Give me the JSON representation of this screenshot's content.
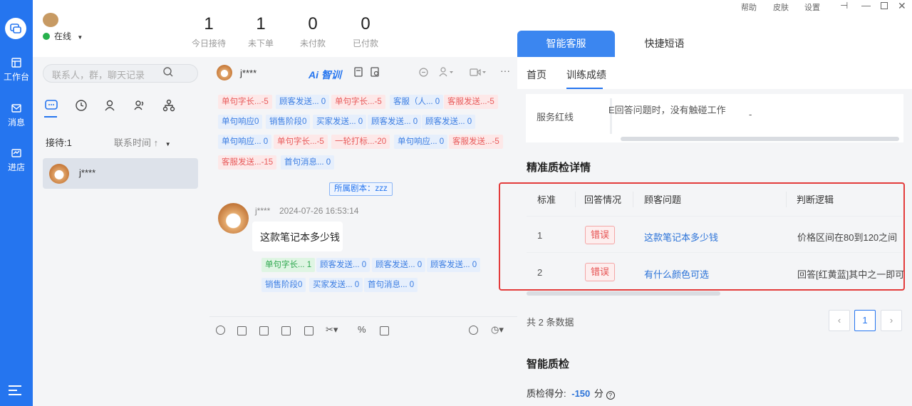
{
  "rail": {
    "items": [
      {
        "label": "工作台"
      },
      {
        "label": "消息"
      },
      {
        "label": "进店"
      }
    ]
  },
  "header": {
    "status": "在线",
    "stats": [
      {
        "value": "1",
        "label": "今日接待"
      },
      {
        "value": "1",
        "label": "未下单"
      },
      {
        "value": "0",
        "label": "未付款"
      },
      {
        "value": "0",
        "label": "已付款"
      }
    ],
    "window_menu": [
      "帮助",
      "皮肤",
      "设置"
    ]
  },
  "contacts": {
    "search_placeholder": "联系人，群，聊天记录",
    "reception": "接待:1",
    "sort": "联系时间",
    "items": [
      {
        "name": "j****"
      }
    ]
  },
  "chat": {
    "contact_name": "j****",
    "ai_label": "Ai 智训",
    "top_tags": [
      {
        "text": "单句字长...-5",
        "color": "red"
      },
      {
        "text": "顾客发送... 0",
        "color": "blue"
      },
      {
        "text": "单句字长...-5",
        "color": "red"
      },
      {
        "text": "客服（人... 0",
        "color": "blue"
      },
      {
        "text": "客服发送...-5",
        "color": "red"
      },
      {
        "text": "单句响应0",
        "color": "blue"
      },
      {
        "text": "销售阶段0",
        "color": "blue"
      },
      {
        "text": "买家发送... 0",
        "color": "blue"
      },
      {
        "text": "顾客发送... 0",
        "color": "blue"
      },
      {
        "text": "顾客发送... 0",
        "color": "blue"
      },
      {
        "text": "单句响应... 0",
        "color": "blue"
      },
      {
        "text": "单句字长...-5",
        "color": "red"
      },
      {
        "text": "一轮打标...-20",
        "color": "red"
      },
      {
        "text": "单句响应... 0",
        "color": "blue"
      },
      {
        "text": "客服发送...-5",
        "color": "red"
      },
      {
        "text": "客服发送...-15",
        "color": "red"
      },
      {
        "text": "首句消息... 0",
        "color": "blue"
      }
    ],
    "script_label": "所属剧本：zzz",
    "message": {
      "sender": "j****",
      "time": "2024-07-26 16:53:14",
      "text": "这款笔记本多少钱"
    },
    "message_tags": [
      {
        "text": "单句字长... 1",
        "color": "green"
      },
      {
        "text": "顾客发送... 0",
        "color": "blue"
      },
      {
        "text": "顾客发送... 0",
        "color": "blue"
      },
      {
        "text": "顾客发送... 0",
        "color": "blue"
      },
      {
        "text": "销售阶段0",
        "color": "blue"
      },
      {
        "text": "买家发送... 0",
        "color": "blue"
      },
      {
        "text": "首句消息... 0",
        "color": "blue"
      }
    ]
  },
  "right": {
    "tabs": [
      "智能客服",
      "快捷短语"
    ],
    "subtabs": [
      "首页",
      "训练成绩"
    ],
    "redline_label": "服务红线",
    "redline_text": "E回答问题时，没有触碰工作",
    "redline_value": "-",
    "detail_title": "精准质检详情",
    "table": {
      "headers": [
        "标准",
        "回答情况",
        "顾客问题",
        "判断逻辑"
      ],
      "rows": [
        {
          "idx": "1",
          "status": "错误",
          "question": "这款笔记本多少钱",
          "logic": "价格区间在80到120之间"
        },
        {
          "idx": "2",
          "status": "错误",
          "question": "有什么颜色可选",
          "logic": "回答[红黄蓝]其中之一即可"
        }
      ]
    },
    "total": "共 2 条数据",
    "page": "1",
    "quality_title": "智能质检",
    "score_label": "质检得分:",
    "score_value": "-150",
    "score_unit": "分"
  }
}
